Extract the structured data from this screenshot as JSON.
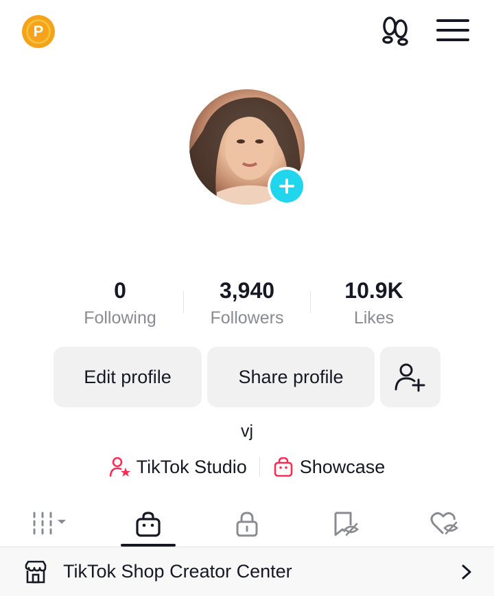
{
  "header": {
    "points_badge_letter": "P",
    "icons": [
      "points-badge",
      "footprint-icon",
      "menu-icon"
    ]
  },
  "profile": {
    "handle": "vj"
  },
  "stats": [
    {
      "value": "0",
      "label": "Following"
    },
    {
      "value": "3,940",
      "label": "Followers"
    },
    {
      "value": "10.9K",
      "label": "Likes"
    }
  ],
  "buttons": {
    "edit": "Edit profile",
    "share": "Share profile"
  },
  "links": {
    "studio": "TikTok Studio",
    "showcase": "Showcase"
  },
  "tabs": [
    "videos-grid",
    "shop-bag",
    "private-lock",
    "saved-bookmark",
    "liked-heart"
  ],
  "shop_banner": {
    "label": "TikTok Shop Creator Center"
  },
  "colors": {
    "accent_cyan": "#20d5ec",
    "accent_pink": "#fe2c55",
    "badge_orange": "#f7a21b"
  }
}
